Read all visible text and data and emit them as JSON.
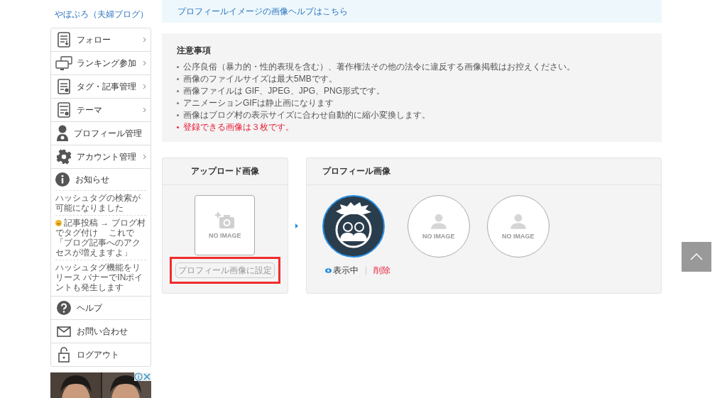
{
  "sidebar": {
    "blog_name": "やぼぷろ（夫婦ブログ）",
    "menu": [
      {
        "label": "フォロー"
      },
      {
        "label": "ランキング参加"
      },
      {
        "label": "タグ・記事管理"
      },
      {
        "label": "テーマ"
      },
      {
        "label": "プロフィール管理"
      },
      {
        "label": "アカウント管理"
      }
    ],
    "notices": {
      "title": "お知らせ",
      "items": [
        {
          "text": "ハッシュタグの検索が可能になりました",
          "kind": "plain"
        },
        {
          "text": "記事投稿 → ブログ村でタグ付け　 これで「ブログ記事へのアクセスが増えますよ」",
          "kind": "emoji"
        },
        {
          "text": "ハッシュタグ機能をリリース バナーでINポイントも発生します",
          "kind": "plain"
        }
      ]
    },
    "links": [
      {
        "label": "ヘルプ"
      },
      {
        "label": "お問い合わせ"
      },
      {
        "label": "ログアウト"
      }
    ]
  },
  "help_link": "プロフィールイメージの画像ヘルプはこちら",
  "notes": {
    "title": "注意事項",
    "items": [
      {
        "text": "公序良俗（暴力的・性的表現を含む）、著作権法その他の法令に違反する画像掲載はお控えください。",
        "kind": "normal"
      },
      {
        "text": "画像のファイルサイズは最大5MBです。",
        "kind": "normal"
      },
      {
        "text": "画像ファイルは GIF、JPEG、JPG、PNG形式です。",
        "kind": "normal"
      },
      {
        "text": "アニメーションGIFは静止画になります",
        "kind": "normal"
      },
      {
        "text": "画像はブログ村の表示サイズに合わせ自動的に縮小変換します。",
        "kind": "normal"
      },
      {
        "text": "登録できる画像は３枚です。",
        "kind": "warning"
      }
    ]
  },
  "upload_panel": {
    "title": "アップロード画像",
    "no_image": "NO IMAGE",
    "button": {
      "label": "プロフィール画像に設定",
      "disabled": true,
      "highlighted": true
    }
  },
  "profile_panel": {
    "title": "プロフィール画像",
    "slots": [
      {
        "kind": "avatar",
        "selected": true
      },
      {
        "kind": "empty",
        "selected": false,
        "no_image": "NO IMAGE"
      },
      {
        "kind": "empty",
        "selected": false,
        "no_image": "NO IMAGE"
      }
    ],
    "status": "表示中",
    "delete": "削除"
  }
}
